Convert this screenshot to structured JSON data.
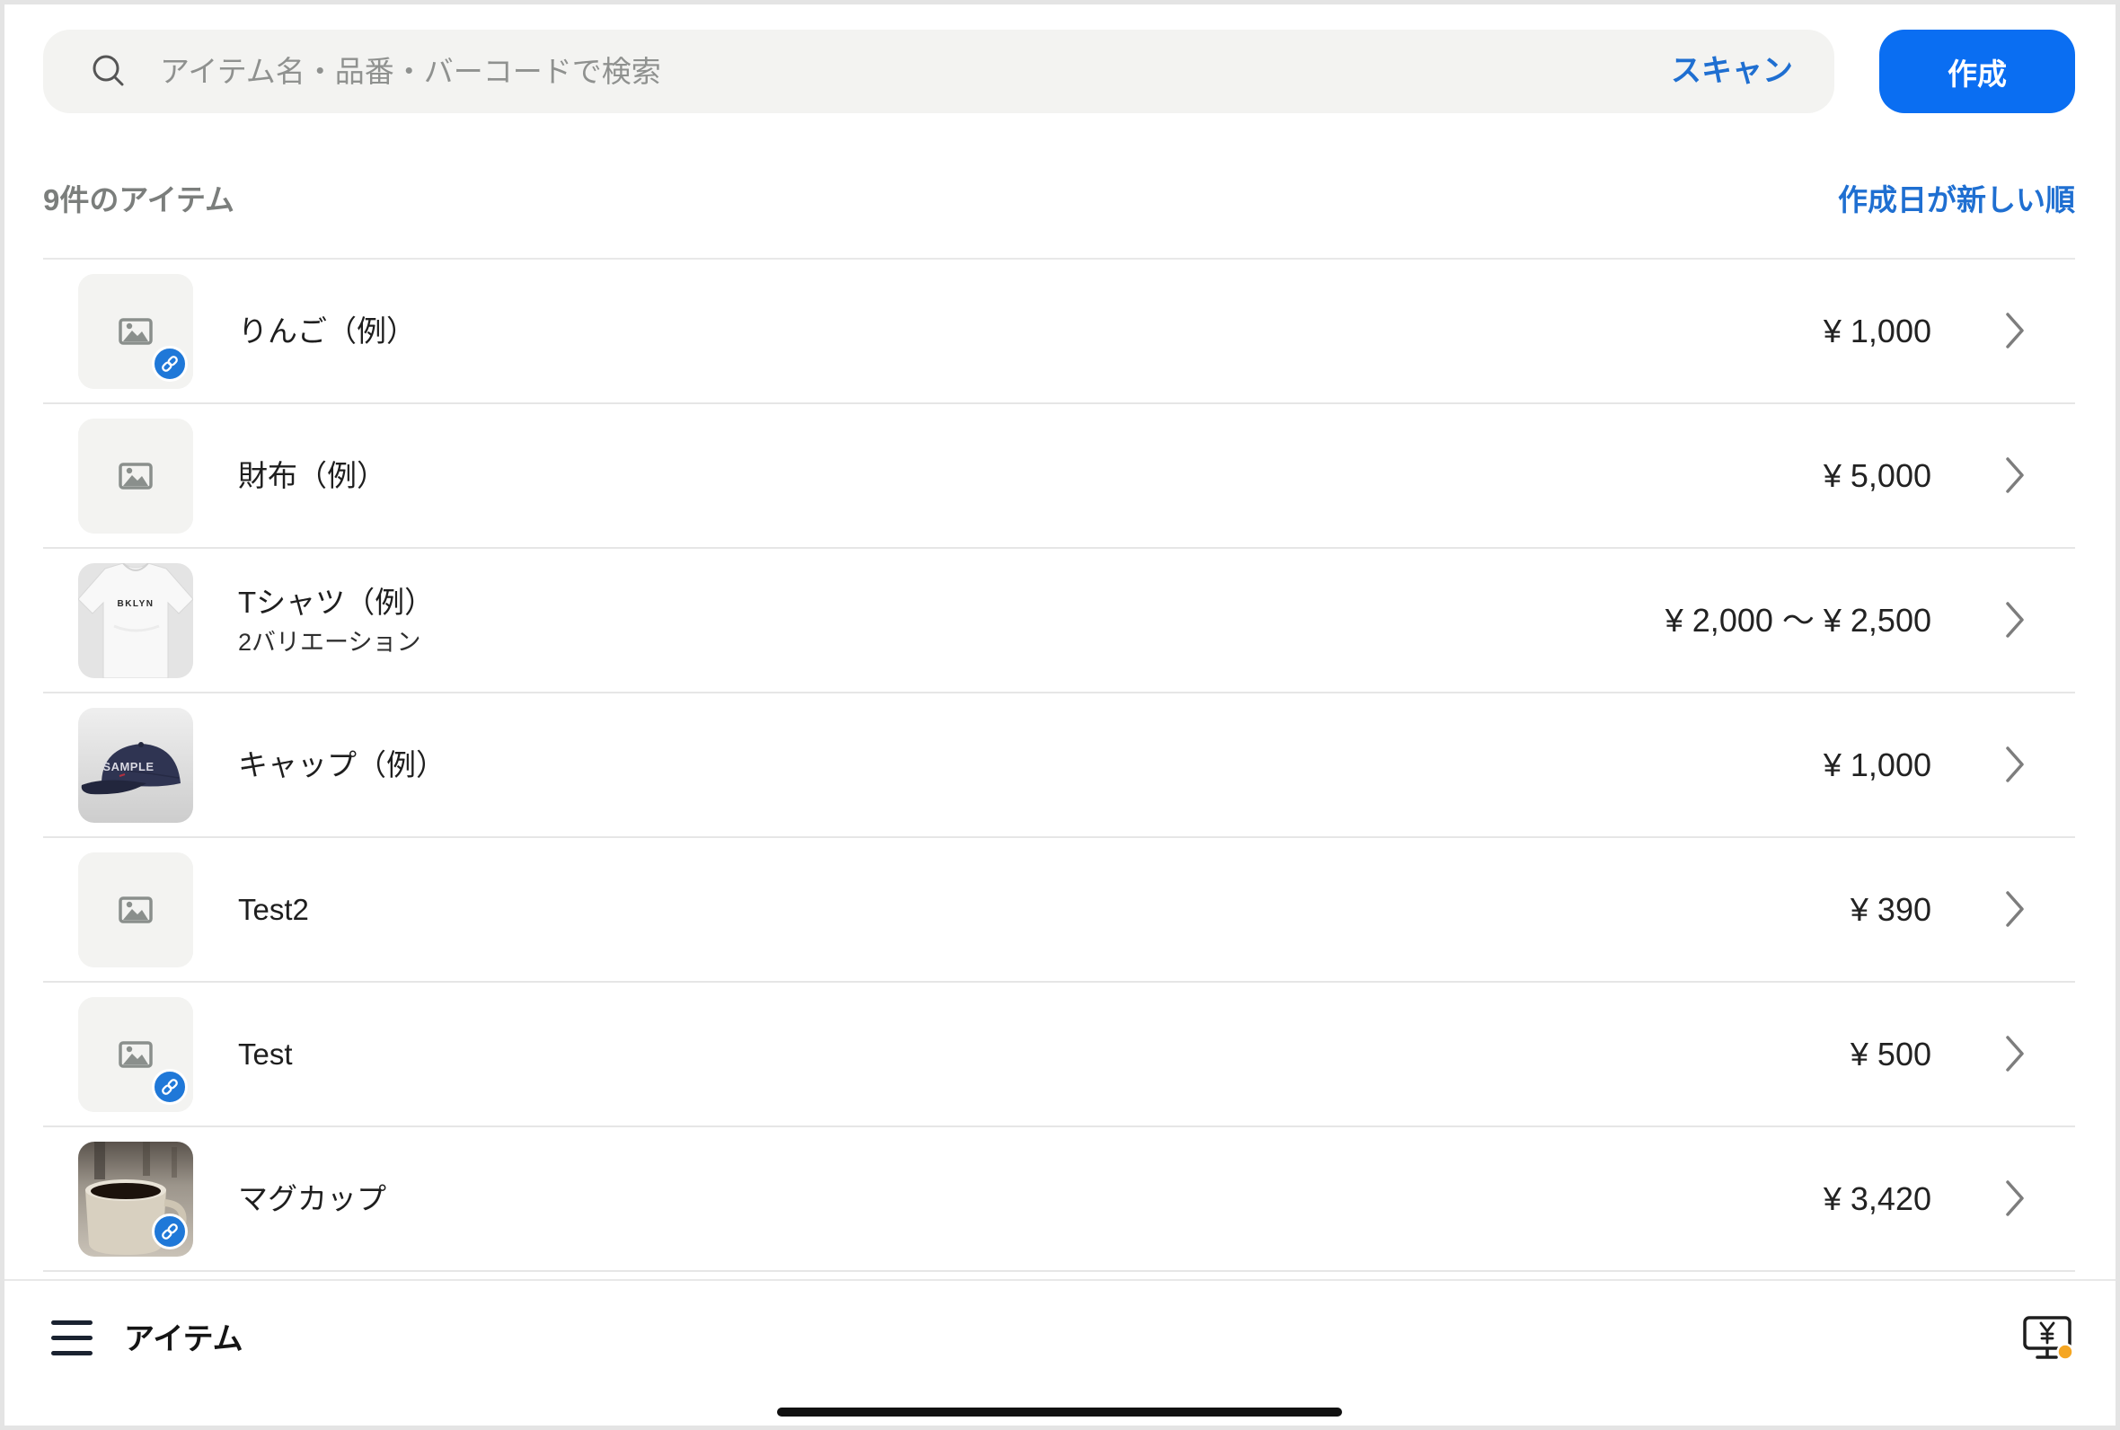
{
  "search": {
    "placeholder": "アイテム名・品番・バーコードで検索",
    "scan_label": "スキャン",
    "icon": "search-icon"
  },
  "toolbar": {
    "create_label": "作成"
  },
  "list_header": {
    "count_label": "9件のアイテム",
    "sort_label": "作成日が新しい順"
  },
  "items": [
    {
      "name": "りんご（例）",
      "price": "¥ 1,000",
      "thumbnail": "image-placeholder-icon",
      "linked": true
    },
    {
      "name": "財布（例）",
      "price": "¥ 5,000",
      "thumbnail": "image-placeholder-icon",
      "linked": false
    },
    {
      "name": "Tシャツ（例）",
      "subtitle": "2バリエーション",
      "price": "¥ 2,000 〜 ¥ 2,500",
      "thumbnail": "tshirt-photo",
      "thumbnail_text": "BKLYN",
      "linked": false
    },
    {
      "name": "キャップ（例）",
      "price": "¥ 1,000",
      "thumbnail": "cap-photo",
      "thumbnail_text": "SAMPLE",
      "linked": false
    },
    {
      "name": "Test2",
      "price": "¥ 390",
      "thumbnail": "image-placeholder-icon",
      "linked": false
    },
    {
      "name": "Test",
      "price": "¥ 500",
      "thumbnail": "image-placeholder-icon",
      "linked": true
    },
    {
      "name": "マグカップ",
      "price": "¥ 3,420",
      "thumbnail": "mug-photo",
      "linked": true
    }
  ],
  "bottom_bar": {
    "title": "アイテム",
    "menu_icon": "hamburger-menu-icon",
    "register_icon": "register-monitor-icon"
  },
  "colors": {
    "accent": "#0a6ef2",
    "link_text": "#1f6fd1",
    "link_badge": "#1f78d8",
    "status_dot": "#f5a623"
  }
}
